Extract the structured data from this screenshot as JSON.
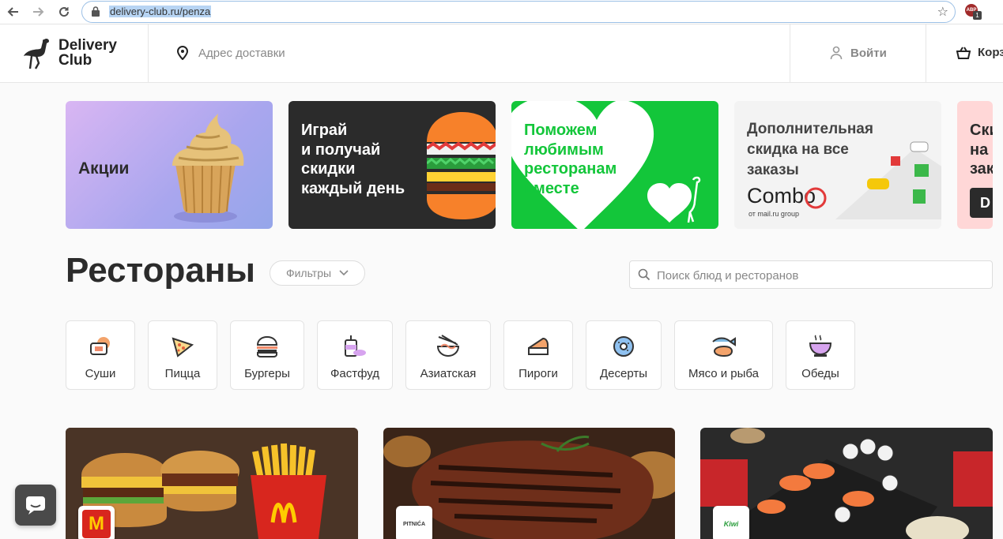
{
  "browser": {
    "url": "delivery-club.ru/penza",
    "extension_label": "ABP",
    "extension_badge": "1"
  },
  "header": {
    "logo_line1": "Delivery",
    "logo_line2": "Club",
    "address_placeholder": "Адрес доставки",
    "login_label": "Войти",
    "cart_label": "Корз"
  },
  "banners": [
    {
      "title": "Акции"
    },
    {
      "title": "Играй\nи получай\nскидки\nкаждый день"
    },
    {
      "title": "Поможем\nлюбимым\nресторанам\nвместе"
    },
    {
      "title": "Дополнительная\nскидка на все\nзаказы",
      "brand": "Combo",
      "brand_sub": "от mail.ru group"
    },
    {
      "title": "Ски\nна\nзак",
      "button": "D"
    }
  ],
  "main": {
    "title": "Рестораны",
    "filters_label": "Фильтры",
    "search_placeholder": "Поиск блюд и ресторанов"
  },
  "categories": [
    {
      "label": "Суши",
      "icon": "sushi-icon"
    },
    {
      "label": "Пицца",
      "icon": "pizza-icon"
    },
    {
      "label": "Бургеры",
      "icon": "burger-icon"
    },
    {
      "label": "Фастфуд",
      "icon": "fastfood-icon"
    },
    {
      "label": "Азиатская",
      "icon": "asian-bowl-icon"
    },
    {
      "label": "Пироги",
      "icon": "pie-icon"
    },
    {
      "label": "Десерты",
      "icon": "donut-icon"
    },
    {
      "label": "Мясо и рыба",
      "icon": "meat-fish-icon"
    },
    {
      "label": "Обеды",
      "icon": "lunch-cup-icon"
    }
  ],
  "restaurants": [
    {
      "logo_text": "M"
    },
    {
      "logo_text": "PITNIĆA"
    },
    {
      "logo_text": "Kiwi"
    }
  ],
  "colors": {
    "accent_green": "#13c63a",
    "brand_dark": "#2b2b2b"
  }
}
